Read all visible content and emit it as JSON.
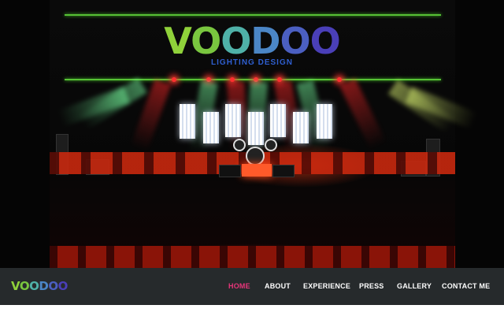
{
  "brand": {
    "logo_letters": [
      "V",
      "O",
      "O",
      "D",
      "O",
      "O"
    ],
    "tagline": "LIGHTING DESIGN"
  },
  "nav": {
    "items": [
      {
        "label": "HOME",
        "active": true
      },
      {
        "label": "ABOUT",
        "active": false
      },
      {
        "label": "EXPERIENCE",
        "active": false
      },
      {
        "label": "PRESS",
        "active": false
      },
      {
        "label": "GALLERY",
        "active": false
      },
      {
        "label": "CONTACT ME",
        "active": false
      }
    ]
  },
  "colors": {
    "nav_background": "#262a2c",
    "nav_active": "#e8357a",
    "nav_text": "#ffffff",
    "accent_green": "#57c235",
    "logo_blue": "#4b5fc1"
  }
}
